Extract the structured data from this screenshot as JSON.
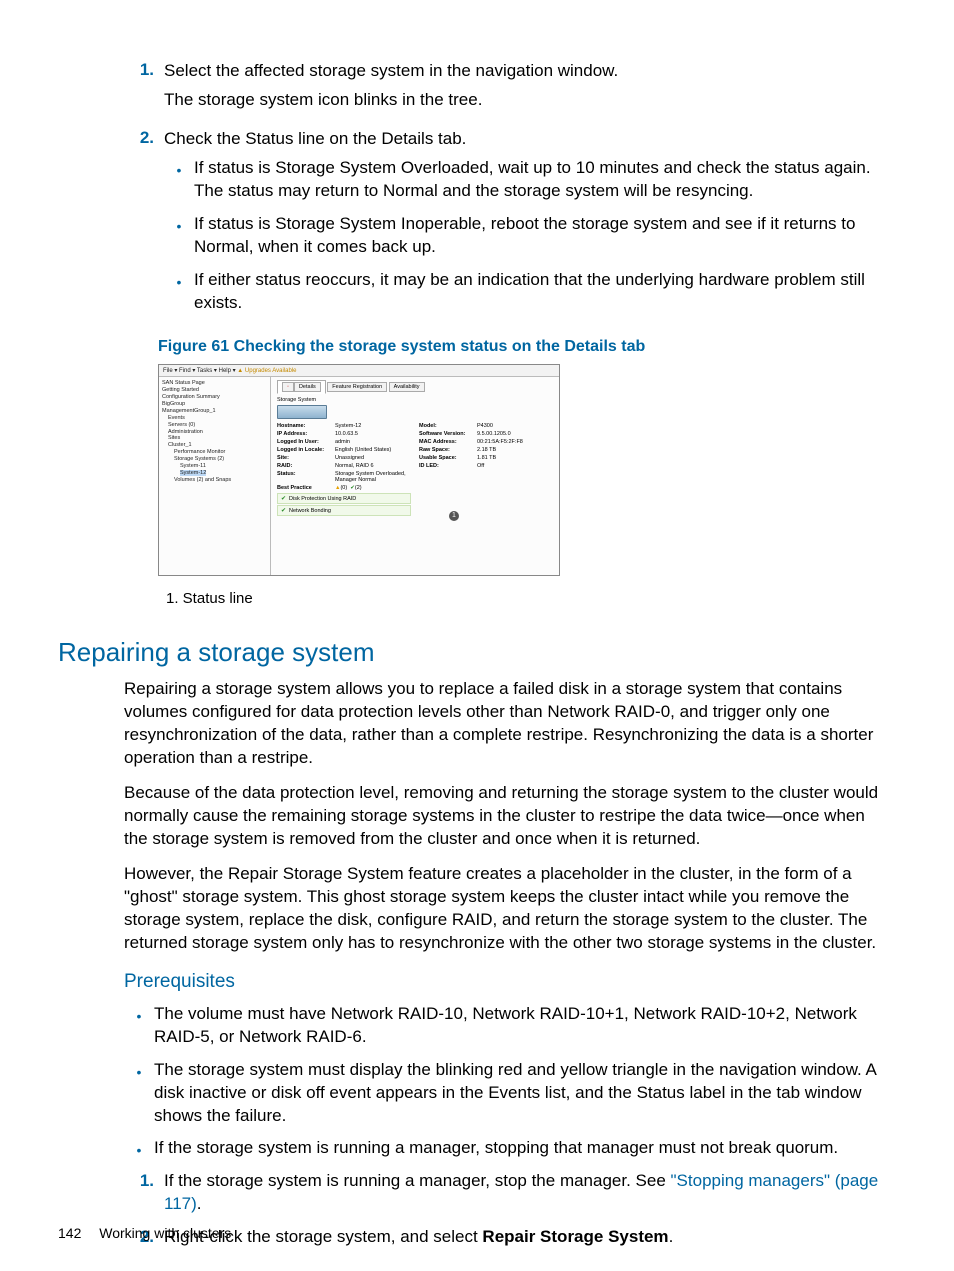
{
  "steps_top": [
    {
      "num": "1.",
      "lines": [
        "Select the affected storage system in the navigation window.",
        "The storage system icon blinks in the tree."
      ]
    },
    {
      "num": "2.",
      "lines": [
        "Check the Status line on the Details tab."
      ],
      "sub": [
        "If status is Storage System Overloaded, wait up to 10 minutes and check the status again. The status may return to Normal and the storage system will be resyncing.",
        "If status is Storage System Inoperable, reboot the storage system and see if it returns to Normal, when it comes back up.",
        "If either status reoccurs, it may be an indication that the underlying hardware problem still exists."
      ]
    }
  ],
  "figure": {
    "caption": "Figure 61 Checking the storage system status on the Details tab",
    "toolbar": "File ▾   Find ▾   Tasks ▾   Help ▾   ",
    "toolbar_upgrades": "▲ Upgrades Available",
    "tree": [
      {
        "t": "SAN Status Page",
        "cls": ""
      },
      {
        "t": "Getting Started",
        "cls": ""
      },
      {
        "t": "Configuration Summary",
        "cls": ""
      },
      {
        "t": "BigGroup",
        "cls": ""
      },
      {
        "t": "ManagementGroup_1",
        "cls": ""
      },
      {
        "t": "Events",
        "cls": "indent1"
      },
      {
        "t": "Servers (0)",
        "cls": "indent1"
      },
      {
        "t": "Administration",
        "cls": "indent1"
      },
      {
        "t": "Sites",
        "cls": "indent1"
      },
      {
        "t": "Cluster_1",
        "cls": "indent1"
      },
      {
        "t": "Performance Monitor",
        "cls": "indent2"
      },
      {
        "t": "Storage Systems (2)",
        "cls": "indent2"
      },
      {
        "t": "System-11",
        "cls": "indent3"
      },
      {
        "t": "System-12",
        "cls": "indent3 sel"
      },
      {
        "t": "Volumes (2) and Snaps",
        "cls": "indent2"
      }
    ],
    "tabs": [
      "Details",
      "Feature Registration",
      "Availability"
    ],
    "fieldset_title": "Storage System",
    "left_rows": [
      {
        "k": "Hostname:",
        "v": "System-12"
      },
      {
        "k": "IP Address:",
        "v": "10.0.63.5"
      },
      {
        "k": "Logged In User:",
        "v": "admin"
      },
      {
        "k": "Logged in Locale:",
        "v": "English (United States)"
      },
      {
        "k": "Site:",
        "v": "Unassigned"
      },
      {
        "k": "RAID:",
        "v": "Normal, RAID 6"
      },
      {
        "k": "Status:",
        "v": "Storage System Overloaded, Manager Normal"
      },
      {
        "k": "Best Practice",
        "v": ""
      }
    ],
    "right_rows": [
      {
        "k": "Model:",
        "v": "P4300"
      },
      {
        "k": "Software Version:",
        "v": "9.5.00.1205.0"
      },
      {
        "k": "MAC Address:",
        "v": "00:21:5A:F5:2F:F8"
      },
      {
        "k": "Raw Space:",
        "v": "2.18 TB"
      },
      {
        "k": "Usable Space:",
        "v": "1.81 TB"
      },
      {
        "k": "ID LED:",
        "v": "Off"
      }
    ],
    "bp_badge1": "(0)",
    "bp_badge2": "(2)",
    "bp_items": [
      "Disk Protection Using RAID",
      "Network Bonding"
    ],
    "callout": "1",
    "legend": "1. Status line"
  },
  "section_heading": "Repairing a storage system",
  "paras": [
    "Repairing a storage system allows you to replace a failed disk in a storage system that contains volumes configured for data protection levels other than Network RAID-0, and trigger only one resynchronization of the data, rather than a complete restripe. Resynchronizing the data is a shorter operation than a restripe.",
    "Because of the data protection level, removing and returning the storage system to the cluster would normally cause the remaining storage systems in the cluster to restripe the data twice—once when the storage system is removed from the cluster and once when it is returned.",
    "However, the Repair Storage System feature creates a placeholder in the cluster, in the form of a \"ghost\" storage system. This ghost storage system keeps the cluster intact while you remove the storage system, replace the disk, configure RAID, and return the storage system to the cluster. The returned storage system only has to resynchronize with the other two storage systems in the cluster."
  ],
  "prereq_heading": "Prerequisites",
  "prereq_bullets": [
    "The volume must have Network RAID-10, Network RAID-10+1, Network RAID-10+2, Network RAID-5, or Network RAID-6.",
    "The storage system must display the blinking red and yellow triangle in the navigation window. A disk inactive or disk off event appears in the Events list, and the Status label in the tab window shows the failure.",
    "If the storage system is running a manager, stopping that manager must not break quorum."
  ],
  "prereq_steps": [
    {
      "num": "1.",
      "pre": "If the storage system is running a manager, stop the manager. See ",
      "link": "\"Stopping managers\" (page 117)",
      "post": "."
    },
    {
      "num": "2.",
      "pre": "Right-click the storage system, and select ",
      "bold": "Repair Storage System",
      "post": "."
    }
  ],
  "footer": {
    "page_number": "142",
    "chapter": "Working with clusters"
  }
}
